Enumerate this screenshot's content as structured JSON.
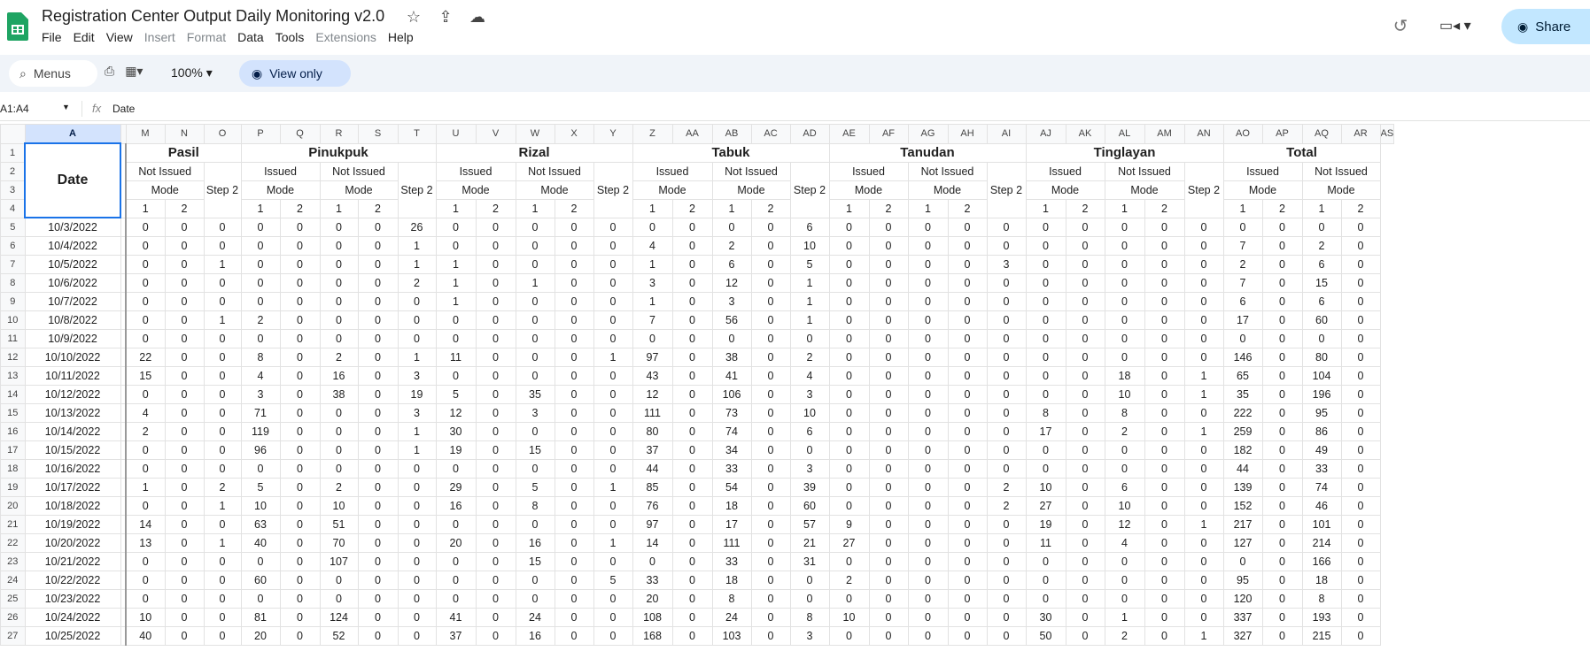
{
  "app": {
    "title": "Registration Center Output Daily Monitoring v2.0",
    "menus": [
      {
        "label": "File",
        "enabled": true
      },
      {
        "label": "Edit",
        "enabled": true
      },
      {
        "label": "View",
        "enabled": true
      },
      {
        "label": "Insert",
        "enabled": false
      },
      {
        "label": "Format",
        "enabled": false
      },
      {
        "label": "Data",
        "enabled": true
      },
      {
        "label": "Tools",
        "enabled": true
      },
      {
        "label": "Extensions",
        "enabled": false
      },
      {
        "label": "Help",
        "enabled": true
      }
    ],
    "share_label": "Share"
  },
  "toolbar": {
    "search_placeholder": "Menus",
    "zoom": "100%",
    "view_only_label": "View only"
  },
  "formula_bar": {
    "name_box": "A1:A4",
    "fx": "fx",
    "value": "Date"
  },
  "sheet": {
    "col_letters": [
      "A",
      "M",
      "N",
      "O",
      "P",
      "Q",
      "R",
      "S",
      "T",
      "U",
      "V",
      "W",
      "X",
      "Y",
      "Z",
      "AA",
      "AB",
      "AC",
      "AD",
      "AE",
      "AF",
      "AG",
      "AH",
      "AI",
      "AJ",
      "AK",
      "AL",
      "AM",
      "AN",
      "AO",
      "AP",
      "AQ",
      "AR",
      "AS"
    ],
    "col_a_header": "Date",
    "groups": [
      "Pasil",
      "Pinukpuk",
      "Rizal",
      "Tabuk",
      "Tanudan",
      "Tinglayan",
      "Total"
    ],
    "sub_labels": {
      "issued": "Issued",
      "not_issued": "Not Issued",
      "mode": "Mode",
      "step2": "Step 2",
      "m1": "1",
      "m2": "2"
    },
    "rows": [
      {
        "n": "5",
        "date": "10/3/2022",
        "v": [
          "0",
          "0",
          "0",
          "0",
          "0",
          "0",
          "0",
          "26",
          "0",
          "0",
          "0",
          "0",
          "0",
          "0",
          "0",
          "0",
          "0",
          "6",
          "0",
          "0",
          "0",
          "0",
          "0",
          "0",
          "0",
          "0",
          "0",
          "0",
          "0",
          "0",
          "0",
          "0"
        ]
      },
      {
        "n": "6",
        "date": "10/4/2022",
        "v": [
          "0",
          "0",
          "0",
          "0",
          "0",
          "0",
          "0",
          "1",
          "0",
          "0",
          "0",
          "0",
          "0",
          "4",
          "0",
          "2",
          "0",
          "10",
          "0",
          "0",
          "0",
          "0",
          "0",
          "0",
          "0",
          "0",
          "0",
          "0",
          "7",
          "0",
          "2",
          "0"
        ]
      },
      {
        "n": "7",
        "date": "10/5/2022",
        "v": [
          "0",
          "0",
          "1",
          "0",
          "0",
          "0",
          "0",
          "1",
          "1",
          "0",
          "0",
          "0",
          "0",
          "1",
          "0",
          "6",
          "0",
          "5",
          "0",
          "0",
          "0",
          "0",
          "3",
          "0",
          "0",
          "0",
          "0",
          "0",
          "2",
          "0",
          "6",
          "0"
        ]
      },
      {
        "n": "8",
        "date": "10/6/2022",
        "v": [
          "0",
          "0",
          "0",
          "0",
          "0",
          "0",
          "0",
          "2",
          "1",
          "0",
          "1",
          "0",
          "0",
          "3",
          "0",
          "12",
          "0",
          "1",
          "0",
          "0",
          "0",
          "0",
          "0",
          "0",
          "0",
          "0",
          "0",
          "0",
          "7",
          "0",
          "15",
          "0"
        ]
      },
      {
        "n": "9",
        "date": "10/7/2022",
        "v": [
          "0",
          "0",
          "0",
          "0",
          "0",
          "0",
          "0",
          "0",
          "1",
          "0",
          "0",
          "0",
          "0",
          "1",
          "0",
          "3",
          "0",
          "1",
          "0",
          "0",
          "0",
          "0",
          "0",
          "0",
          "0",
          "0",
          "0",
          "0",
          "6",
          "0",
          "6",
          "0"
        ]
      },
      {
        "n": "10",
        "date": "10/8/2022",
        "v": [
          "0",
          "0",
          "1",
          "2",
          "0",
          "0",
          "0",
          "0",
          "0",
          "0",
          "0",
          "0",
          "0",
          "7",
          "0",
          "56",
          "0",
          "1",
          "0",
          "0",
          "0",
          "0",
          "0",
          "0",
          "0",
          "0",
          "0",
          "0",
          "17",
          "0",
          "60",
          "0"
        ]
      },
      {
        "n": "11",
        "date": "10/9/2022",
        "v": [
          "0",
          "0",
          "0",
          "0",
          "0",
          "0",
          "0",
          "0",
          "0",
          "0",
          "0",
          "0",
          "0",
          "0",
          "0",
          "0",
          "0",
          "0",
          "0",
          "0",
          "0",
          "0",
          "0",
          "0",
          "0",
          "0",
          "0",
          "0",
          "0",
          "0",
          "0",
          "0"
        ]
      },
      {
        "n": "12",
        "date": "10/10/2022",
        "v": [
          "22",
          "0",
          "0",
          "8",
          "0",
          "2",
          "0",
          "1",
          "11",
          "0",
          "0",
          "0",
          "1",
          "97",
          "0",
          "38",
          "0",
          "2",
          "0",
          "0",
          "0",
          "0",
          "0",
          "0",
          "0",
          "0",
          "0",
          "0",
          "146",
          "0",
          "80",
          "0"
        ]
      },
      {
        "n": "13",
        "date": "10/11/2022",
        "v": [
          "15",
          "0",
          "0",
          "4",
          "0",
          "16",
          "0",
          "3",
          "0",
          "0",
          "0",
          "0",
          "0",
          "43",
          "0",
          "41",
          "0",
          "4",
          "0",
          "0",
          "0",
          "0",
          "0",
          "0",
          "0",
          "18",
          "0",
          "1",
          "65",
          "0",
          "104",
          "0"
        ]
      },
      {
        "n": "14",
        "date": "10/12/2022",
        "v": [
          "0",
          "0",
          "0",
          "3",
          "0",
          "38",
          "0",
          "19",
          "5",
          "0",
          "35",
          "0",
          "0",
          "12",
          "0",
          "106",
          "0",
          "3",
          "0",
          "0",
          "0",
          "0",
          "0",
          "0",
          "0",
          "10",
          "0",
          "1",
          "35",
          "0",
          "196",
          "0"
        ]
      },
      {
        "n": "15",
        "date": "10/13/2022",
        "v": [
          "4",
          "0",
          "0",
          "71",
          "0",
          "0",
          "0",
          "3",
          "12",
          "0",
          "3",
          "0",
          "0",
          "111",
          "0",
          "73",
          "0",
          "10",
          "0",
          "0",
          "0",
          "0",
          "0",
          "8",
          "0",
          "8",
          "0",
          "0",
          "222",
          "0",
          "95",
          "0"
        ]
      },
      {
        "n": "16",
        "date": "10/14/2022",
        "v": [
          "2",
          "0",
          "0",
          "119",
          "0",
          "0",
          "0",
          "1",
          "30",
          "0",
          "0",
          "0",
          "0",
          "80",
          "0",
          "74",
          "0",
          "6",
          "0",
          "0",
          "0",
          "0",
          "0",
          "17",
          "0",
          "2",
          "0",
          "1",
          "259",
          "0",
          "86",
          "0"
        ]
      },
      {
        "n": "17",
        "date": "10/15/2022",
        "v": [
          "0",
          "0",
          "0",
          "96",
          "0",
          "0",
          "0",
          "1",
          "19",
          "0",
          "15",
          "0",
          "0",
          "37",
          "0",
          "34",
          "0",
          "0",
          "0",
          "0",
          "0",
          "0",
          "0",
          "0",
          "0",
          "0",
          "0",
          "0",
          "182",
          "0",
          "49",
          "0"
        ]
      },
      {
        "n": "18",
        "date": "10/16/2022",
        "v": [
          "0",
          "0",
          "0",
          "0",
          "0",
          "0",
          "0",
          "0",
          "0",
          "0",
          "0",
          "0",
          "0",
          "44",
          "0",
          "33",
          "0",
          "3",
          "0",
          "0",
          "0",
          "0",
          "0",
          "0",
          "0",
          "0",
          "0",
          "0",
          "44",
          "0",
          "33",
          "0"
        ]
      },
      {
        "n": "19",
        "date": "10/17/2022",
        "v": [
          "1",
          "0",
          "2",
          "5",
          "0",
          "2",
          "0",
          "0",
          "29",
          "0",
          "5",
          "0",
          "1",
          "85",
          "0",
          "54",
          "0",
          "39",
          "0",
          "0",
          "0",
          "0",
          "2",
          "10",
          "0",
          "6",
          "0",
          "0",
          "139",
          "0",
          "74",
          "0"
        ]
      },
      {
        "n": "20",
        "date": "10/18/2022",
        "v": [
          "0",
          "0",
          "1",
          "10",
          "0",
          "10",
          "0",
          "0",
          "16",
          "0",
          "8",
          "0",
          "0",
          "76",
          "0",
          "18",
          "0",
          "60",
          "0",
          "0",
          "0",
          "0",
          "2",
          "27",
          "0",
          "10",
          "0",
          "0",
          "152",
          "0",
          "46",
          "0"
        ]
      },
      {
        "n": "21",
        "date": "10/19/2022",
        "v": [
          "14",
          "0",
          "0",
          "63",
          "0",
          "51",
          "0",
          "0",
          "0",
          "0",
          "0",
          "0",
          "0",
          "97",
          "0",
          "17",
          "0",
          "57",
          "9",
          "0",
          "0",
          "0",
          "0",
          "19",
          "0",
          "12",
          "0",
          "1",
          "217",
          "0",
          "101",
          "0"
        ]
      },
      {
        "n": "22",
        "date": "10/20/2022",
        "v": [
          "13",
          "0",
          "1",
          "40",
          "0",
          "70",
          "0",
          "0",
          "20",
          "0",
          "16",
          "0",
          "1",
          "14",
          "0",
          "111",
          "0",
          "21",
          "27",
          "0",
          "0",
          "0",
          "0",
          "11",
          "0",
          "4",
          "0",
          "0",
          "127",
          "0",
          "214",
          "0"
        ]
      },
      {
        "n": "23",
        "date": "10/21/2022",
        "v": [
          "0",
          "0",
          "0",
          "0",
          "0",
          "107",
          "0",
          "0",
          "0",
          "0",
          "15",
          "0",
          "0",
          "0",
          "0",
          "33",
          "0",
          "31",
          "0",
          "0",
          "0",
          "0",
          "0",
          "0",
          "0",
          "0",
          "0",
          "0",
          "0",
          "0",
          "166",
          "0"
        ]
      },
      {
        "n": "24",
        "date": "10/22/2022",
        "v": [
          "0",
          "0",
          "0",
          "60",
          "0",
          "0",
          "0",
          "0",
          "0",
          "0",
          "0",
          "0",
          "5",
          "33",
          "0",
          "18",
          "0",
          "0",
          "2",
          "0",
          "0",
          "0",
          "0",
          "0",
          "0",
          "0",
          "0",
          "0",
          "95",
          "0",
          "18",
          "0"
        ]
      },
      {
        "n": "25",
        "date": "10/23/2022",
        "v": [
          "0",
          "0",
          "0",
          "0",
          "0",
          "0",
          "0",
          "0",
          "0",
          "0",
          "0",
          "0",
          "0",
          "20",
          "0",
          "8",
          "0",
          "0",
          "0",
          "0",
          "0",
          "0",
          "0",
          "0",
          "0",
          "0",
          "0",
          "0",
          "120",
          "0",
          "8",
          "0"
        ]
      },
      {
        "n": "26",
        "date": "10/24/2022",
        "v": [
          "10",
          "0",
          "0",
          "81",
          "0",
          "124",
          "0",
          "0",
          "41",
          "0",
          "24",
          "0",
          "0",
          "108",
          "0",
          "24",
          "0",
          "8",
          "10",
          "0",
          "0",
          "0",
          "0",
          "30",
          "0",
          "1",
          "0",
          "0",
          "337",
          "0",
          "193",
          "0"
        ]
      },
      {
        "n": "27",
        "date": "10/25/2022",
        "v": [
          "40",
          "0",
          "0",
          "20",
          "0",
          "52",
          "0",
          "0",
          "37",
          "0",
          "16",
          "0",
          "0",
          "168",
          "0",
          "103",
          "0",
          "3",
          "0",
          "0",
          "0",
          "0",
          "0",
          "50",
          "0",
          "2",
          "0",
          "1",
          "327",
          "0",
          "215",
          "0"
        ]
      }
    ]
  }
}
